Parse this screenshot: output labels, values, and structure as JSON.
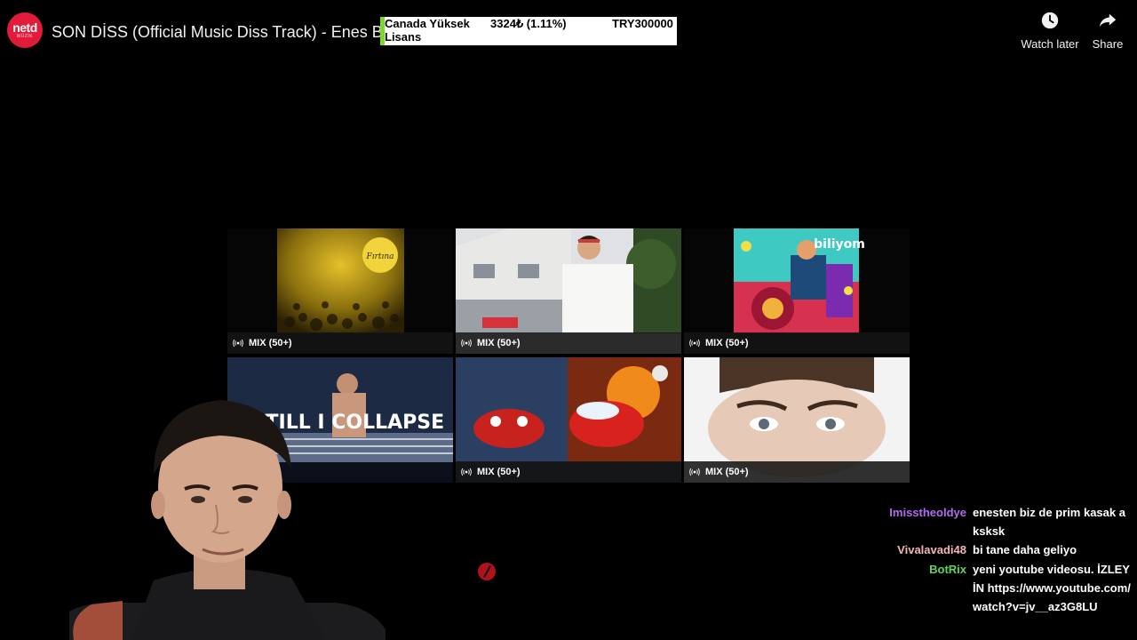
{
  "channel": {
    "logo_main": "netd",
    "logo_sub": "MÜZİK"
  },
  "video": {
    "title": "SON DİSS (Official Music Diss Track) - Enes Batur"
  },
  "ticker": {
    "name": "Canada Yüksek Lisans",
    "price": "3324₺ (1.11%)",
    "volume": "TRY300000",
    "accent_color": "#7cd82a"
  },
  "actions": {
    "watch_later": {
      "label": "Watch later",
      "icon": "clock-icon"
    },
    "share": {
      "label": "Share",
      "icon": "share-arrow-icon"
    }
  },
  "end_screen": {
    "tiles": [
      {
        "id": "mix-1",
        "badge": "MIX (50+)",
        "thumb_overlay": "Fırtına"
      },
      {
        "id": "mix-2",
        "badge": "MIX (50+)"
      },
      {
        "id": "mix-3",
        "badge": "MIX (50+)",
        "thumb_overlay": "biliyom"
      },
      {
        "id": "mix-4",
        "badge": "",
        "thumb_overlay": "'TILL I COLLAPSE"
      },
      {
        "id": "mix-5",
        "badge": "MIX (50+)"
      },
      {
        "id": "mix-6",
        "badge": "MIX (50+)"
      }
    ]
  },
  "chat": {
    "messages": [
      {
        "user": "Imisstheoldye",
        "color": "#b06cf0",
        "text": "enesten biz de prim kasak aksksk"
      },
      {
        "user": "Vivalavadi48",
        "color": "#f2b6b6",
        "text": "bi tane daha geliyo"
      },
      {
        "user": "BotRix",
        "color": "#5fd35f",
        "text": "yeni youtube videosu. İZLEYİN https://www.youtube.com/watch?v=jv__az3G8LU"
      }
    ]
  }
}
